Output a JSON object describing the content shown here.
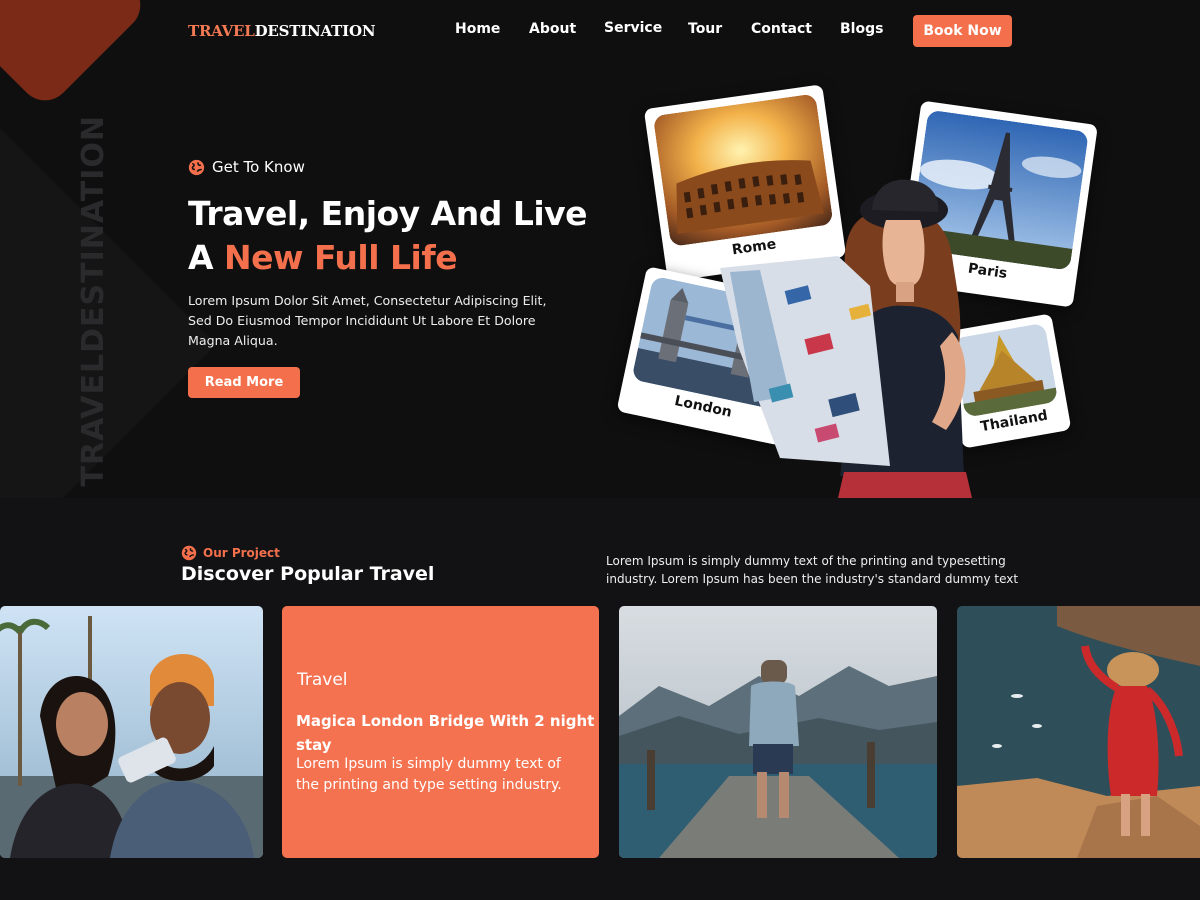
{
  "brand": {
    "part1": "TRAVEL",
    "part2": "DESTINATION",
    "vertical_watermark": "TRAVELDESTINATION"
  },
  "nav": {
    "items": [
      "Home",
      "About",
      "Service",
      "Tour",
      "Contact",
      "Blogs"
    ],
    "cta": "Book Now"
  },
  "hero": {
    "eyebrow": "Get To Know",
    "headline_line1": "Travel, Enjoy And Live",
    "headline_line2_prefix": "A ",
    "headline_line2_highlight": "New Full Life",
    "description": "Lorem Ipsum Dolor Sit Amet, Consectetur Adipiscing Elit, Sed Do Eiusmod Tempor Incididunt Ut Labore Et Dolore Magna Aliqua.",
    "button": "Read More",
    "photo_captions": [
      "Rome",
      "Paris",
      "London",
      "Thailand"
    ]
  },
  "projects": {
    "eyebrow": "Our Project",
    "title": "Discover Popular Travel",
    "description": "Lorem Ipsum is simply dummy text of the printing and typesetting industry. Lorem Ipsum has been the industry's standard dummy text",
    "featured": {
      "label": "Travel",
      "title": "Magica London Bridge With 2 night stay",
      "text": "Lorem Ipsum is simply dummy text of the printing and type setting industry."
    }
  },
  "colors": {
    "accent": "#f46f4c",
    "background": "#121214",
    "hero_background": "#0f0f10",
    "corner_shape": "#7a2a16"
  }
}
